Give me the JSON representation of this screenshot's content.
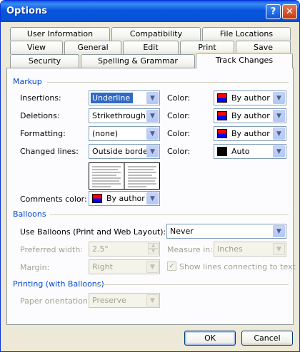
{
  "window": {
    "title": "Options",
    "help_label": "?",
    "close_label": "✕"
  },
  "tabs": {
    "row1": [
      "User Information",
      "Compatibility",
      "File Locations"
    ],
    "row2": [
      "View",
      "General",
      "Edit",
      "Print",
      "Save"
    ],
    "row3": [
      "Security",
      "Spelling & Grammar",
      "Track Changes"
    ],
    "active": "Track Changes"
  },
  "markup": {
    "heading": "Markup",
    "insertions": {
      "label": "Insertions:",
      "value": "Underline",
      "color_label": "Color:",
      "color_value": "By author"
    },
    "deletions": {
      "label": "Deletions:",
      "value": "Strikethrough",
      "color_label": "Color:",
      "color_value": "By author"
    },
    "formatting": {
      "label": "Formatting:",
      "value": "(none)",
      "color_label": "Color:",
      "color_value": "By author"
    },
    "changed_lines": {
      "label": "Changed lines:",
      "value": "Outside border",
      "color_label": "Color:",
      "color_value": "Auto"
    },
    "comments_color": {
      "label": "Comments color:",
      "value": "By author"
    }
  },
  "balloons": {
    "heading": "Balloons",
    "use_balloons": {
      "label": "Use Balloons (Print and Web Layout):",
      "value": "Never"
    },
    "preferred_width": {
      "label": "Preferred width:",
      "value": "2.5\""
    },
    "measure_in": {
      "label": "Measure in:",
      "value": "Inches"
    },
    "margin": {
      "label": "Margin:",
      "value": "Right"
    },
    "show_lines": {
      "label": "Show lines connecting to text",
      "checked": true
    }
  },
  "printing": {
    "heading": "Printing (with Balloons)",
    "paper_orientation": {
      "label": "Paper orientation:",
      "value": "Preserve"
    }
  },
  "buttons": {
    "ok": "OK",
    "cancel": "Cancel"
  },
  "colors": {
    "title_bar": "#0855dd",
    "section_heading": "#0046d5",
    "selection": "#316ac5",
    "active_tab_accent": "#ffc83c"
  }
}
